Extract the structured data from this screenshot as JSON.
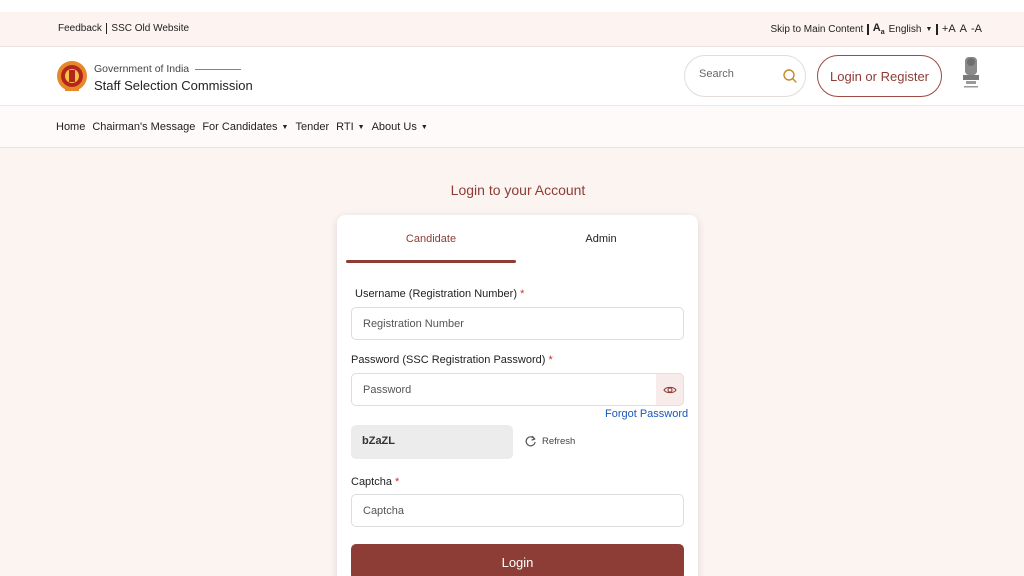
{
  "utility": {
    "feedback": "Feedback",
    "old_website": "SSC Old Website",
    "skip": "Skip to Main Content",
    "language": "English",
    "font_increase": "+A",
    "font_normal": "A",
    "font_decrease": "-A"
  },
  "header": {
    "gov_label": "Government of India",
    "org_name": "Staff Selection Commission",
    "search_placeholder": "Search",
    "login_register": "Login or Register"
  },
  "nav": {
    "items": [
      {
        "label": "Home",
        "has_caret": false
      },
      {
        "label": "Chairman's Message",
        "has_caret": false
      },
      {
        "label": "For Candidates",
        "has_caret": true
      },
      {
        "label": "Tender",
        "has_caret": false
      },
      {
        "label": "RTI",
        "has_caret": true
      },
      {
        "label": "About Us",
        "has_caret": true
      }
    ]
  },
  "login": {
    "heading": "Login to your Account",
    "tabs": [
      {
        "label": "Candidate",
        "active": true
      },
      {
        "label": "Admin",
        "active": false
      }
    ],
    "username_label": "Username (Registration Number)",
    "username_placeholder": "Registration Number",
    "password_label": "Password (SSC Registration Password)",
    "password_placeholder": "Password",
    "forgot_password": "Forgot Password",
    "captcha_code": "bZaZL",
    "refresh_label": "Refresh",
    "captcha_label": "Captcha",
    "captcha_placeholder": "Captcha",
    "required_mark": "*",
    "submit": "Login"
  },
  "colors": {
    "brand": "#8d3d35",
    "link": "#1a56b8",
    "background": "#fbf4f1",
    "required": "#d32f2f"
  }
}
